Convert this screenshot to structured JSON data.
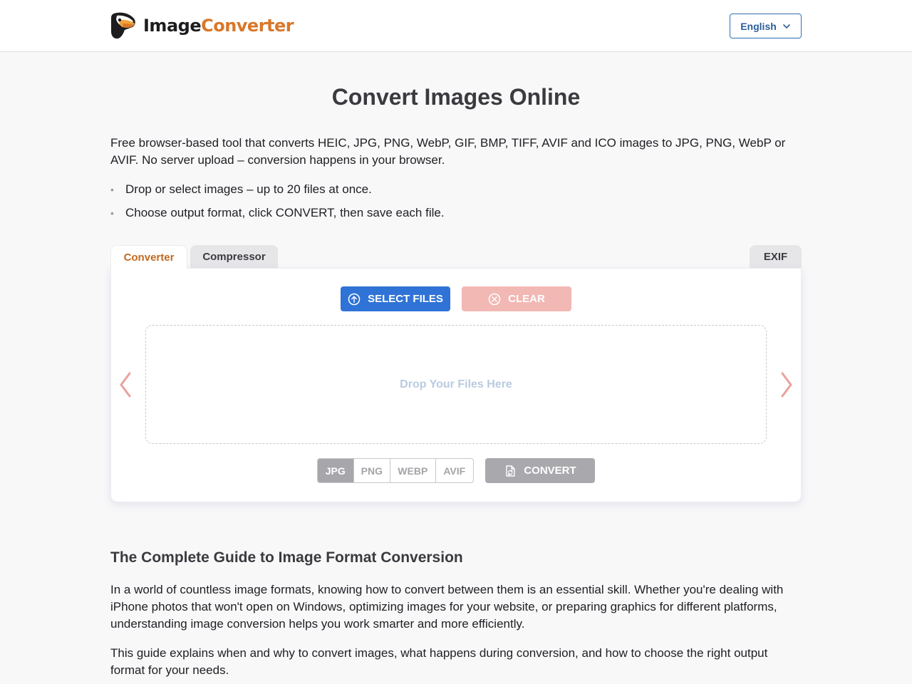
{
  "header": {
    "logo_word1": "Image",
    "logo_word2": "Converter",
    "language_label": "English"
  },
  "main": {
    "title": "Convert Images Online",
    "intro": "Free browser-based tool that converts HEIC, JPG, PNG, WebP, GIF, BMP, TIFF, AVIF and ICO images to JPG, PNG, WebP or AVIF. No server upload – conversion happens in your browser.",
    "bullets": [
      "Drop or select images – up to 20 files at once.",
      "Choose output format, click CONVERT, then save each file."
    ]
  },
  "tabs": [
    {
      "label": "Converter",
      "active": true
    },
    {
      "label": "Compressor",
      "active": false
    },
    {
      "label": "EXIF",
      "active": false
    }
  ],
  "converter": {
    "select_label": "SELECT FILES",
    "clear_label": "CLEAR",
    "dropzone_text": "Drop Your Files Here",
    "formats": [
      "JPG",
      "PNG",
      "WEBP",
      "AVIF"
    ],
    "selected_format": "JPG",
    "convert_label": "CONVERT"
  },
  "guide": {
    "title": "The Complete Guide to Image Format Conversion",
    "p1": "In a world of countless image formats, knowing how to convert between them is an essential skill. Whether you're dealing with iPhone photos that won't open on Windows, optimizing images for your website, or preparing graphics for different platforms, understanding image conversion helps you work smarter and more efficiently.",
    "p2": "This guide explains when and why to convert images, what happens during conversion, and how to choose the right output format for your needs."
  },
  "colors": {
    "accent_orange": "#d9772a",
    "primary_blue": "#2f73d6",
    "clear_pink": "#f2b8b4",
    "disabled_gray": "#a9a9ad",
    "arrow_pink": "#e8a19c"
  },
  "icons": {
    "logo": "toucan-logo-icon",
    "language": "chevron-down-icon",
    "select": "upload-circle-icon",
    "clear": "x-circle-icon",
    "convert": "file-convert-icon",
    "prev": "chevron-left-icon",
    "next": "chevron-right-icon"
  }
}
